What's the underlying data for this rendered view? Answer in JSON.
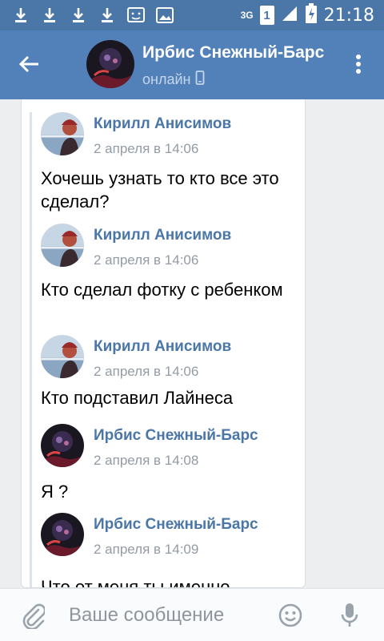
{
  "status_bar": {
    "time": "21:18",
    "network": "3G",
    "sim_slot": "1",
    "icons": [
      "download-icon",
      "download-icon",
      "download-icon",
      "download-icon",
      "sms-notification-icon",
      "image-notification-icon",
      "signal-icon",
      "battery-charging-icon"
    ]
  },
  "header": {
    "title": "Ирбис Снежный-Барс",
    "status": "онлайн",
    "status_icon": "mobile-phone-icon"
  },
  "messages": [
    {
      "author": "Кирилл Анисимов",
      "date": "2 апреля в 14:06",
      "text": "Хочешь узнать то кто все это сделал?"
    },
    {
      "author": "Кирилл Анисимов",
      "date": "2 апреля в 14:06",
      "text": "Кто сделал фотку с ребенком"
    },
    {
      "author": "Кирилл Анисимов",
      "date": "2 апреля в 14:06",
      "text": "Кто подставил Лайнеса"
    },
    {
      "author": "Ирбис Снежный-Барс",
      "date": "2 апреля в 14:08",
      "text": "Я ?"
    },
    {
      "author": "Ирбис Снежный-Барс",
      "date": "2 апреля в 14:09",
      "text": "Что от меня ты именно"
    }
  ],
  "composer": {
    "placeholder": "Ваше сообщение"
  },
  "colors": {
    "status_bar": "#4a76a8",
    "header": "#5181b8",
    "author_link": "#4a76a8",
    "date": "#939ba5"
  }
}
